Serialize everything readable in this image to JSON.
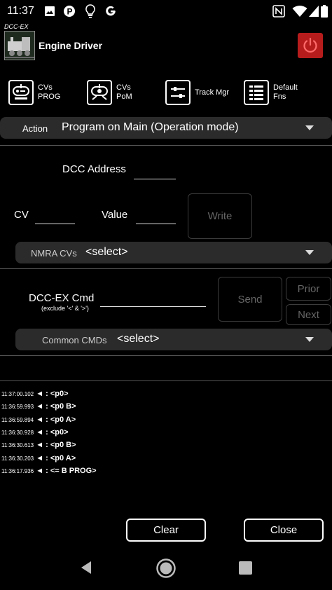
{
  "status_bar": {
    "time": "11:37",
    "left_icons": [
      "image-icon",
      "p-app-icon",
      "bulb-icon",
      "google-icon"
    ],
    "right_icons": [
      "nfc-icon",
      "wifi-icon",
      "signal-icon",
      "battery-icon"
    ]
  },
  "header": {
    "logo_caption": "DCC-EX",
    "title": "Engine Driver"
  },
  "tools": [
    {
      "label1": "CVs",
      "label2": "PROG",
      "icon": "cv-prog-icon"
    },
    {
      "label1": "CVs",
      "label2": "PoM",
      "icon": "cv-pom-icon"
    },
    {
      "label1": "Track Mgr",
      "label2": "",
      "icon": "track-manager-icon"
    },
    {
      "label1": "Default",
      "label2": "Fns",
      "icon": "default-functions-icon"
    }
  ],
  "action": {
    "label": "Action",
    "selected": "Program on Main (Operation mode)"
  },
  "dcc_address": {
    "label": "DCC Address",
    "value": ""
  },
  "cv": {
    "label": "CV",
    "value": ""
  },
  "value": {
    "label": "Value",
    "value": ""
  },
  "write_button": "Write",
  "nmra": {
    "label": "NMRA CVs",
    "selected": "<select>"
  },
  "dccex_cmd": {
    "label": "DCC-EX Cmd",
    "hint": "(exclude '<' & '>')",
    "value": ""
  },
  "send_button": "Send",
  "prior_button": "Prior",
  "next_button": "Next",
  "common": {
    "label": "Common CMDs",
    "selected": "<select>"
  },
  "log": [
    {
      "time": "11:37:00.102",
      "msg": "◄ : <p0>"
    },
    {
      "time": "11:36:59.993",
      "msg": "◄ : <p0 B>"
    },
    {
      "time": "11:36:59.894",
      "msg": "◄ : <p0 A>"
    },
    {
      "time": "11:36:30.928",
      "msg": "◄ : <p0>"
    },
    {
      "time": "11:36:30.613",
      "msg": "◄ : <p0 B>"
    },
    {
      "time": "11:36:30.203",
      "msg": "◄ : <p0 A>"
    },
    {
      "time": "11:36:17.936",
      "msg": "◄ : <= B PROG>"
    }
  ],
  "clear_button": "Clear",
  "close_button": "Close",
  "nav": [
    "back-icon",
    "home-icon",
    "recents-icon"
  ],
  "colors": {
    "power_button": "#b71c1c",
    "power_ring": "#ff3b30"
  }
}
